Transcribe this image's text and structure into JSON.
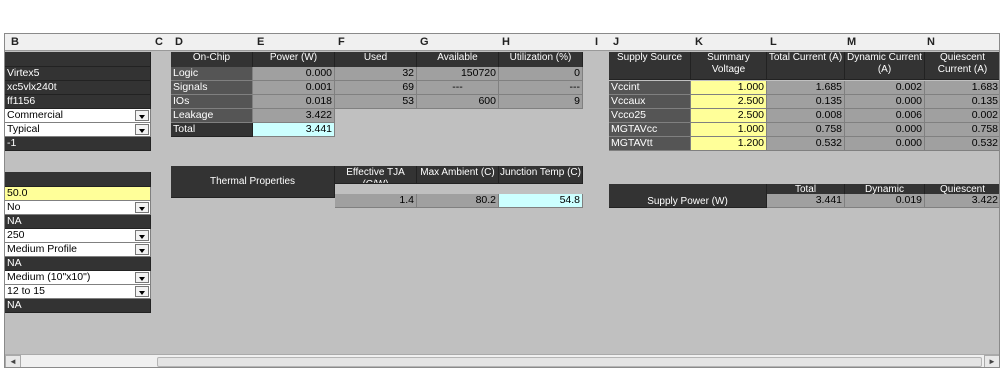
{
  "columns": [
    "B",
    "C",
    "D",
    "E",
    "F",
    "G",
    "H",
    "I",
    "J",
    "K",
    "L",
    "M",
    "N"
  ],
  "settings": {
    "top": [
      {
        "value": "Virtex5",
        "style": "dk"
      },
      {
        "value": "xc5vlx240t",
        "style": "dk"
      },
      {
        "value": "ff1156",
        "style": "dk"
      },
      {
        "value": "Commercial",
        "style": "w",
        "dropdown": true
      },
      {
        "value": "Typical",
        "style": "w",
        "dropdown": true
      },
      {
        "value": "-1",
        "style": "dk"
      }
    ],
    "bottom": [
      {
        "value": "50.0",
        "style": "y"
      },
      {
        "value": "No",
        "style": "w",
        "dropdown": true
      },
      {
        "value": "NA",
        "style": "dk"
      },
      {
        "value": "250",
        "style": "w",
        "dropdown": true
      },
      {
        "value": "Medium Profile",
        "style": "w",
        "dropdown": true
      },
      {
        "value": "NA",
        "style": "dk"
      },
      {
        "value": "Medium (10\"x10\")",
        "style": "w",
        "dropdown": true
      },
      {
        "value": "12 to 15",
        "style": "w",
        "dropdown": true
      },
      {
        "value": "NA",
        "style": "dk"
      }
    ]
  },
  "onchip": {
    "headers": [
      "On-Chip",
      "Power (W)",
      "Used",
      "Available",
      "Utilization (%)"
    ],
    "rows": [
      {
        "name": "Logic",
        "power": "0.000",
        "used": "32",
        "available": "150720",
        "util": "0"
      },
      {
        "name": "Signals",
        "power": "0.001",
        "used": "69",
        "available": "---",
        "util": "---"
      },
      {
        "name": "IOs",
        "power": "0.018",
        "used": "53",
        "available": "600",
        "util": "9"
      },
      {
        "name": "Leakage",
        "power": "3.422",
        "used": "",
        "available": "",
        "util": ""
      },
      {
        "name": "Total",
        "power": "3.441",
        "used": "",
        "available": "",
        "util": ""
      }
    ]
  },
  "thermal": {
    "label": "Thermal Properties",
    "headers": [
      "Effective TJA (C/W)",
      "Max Ambient (C)",
      "Junction Temp (C)"
    ],
    "values": [
      "1.4",
      "80.2",
      "54.8"
    ]
  },
  "supply": {
    "headers": [
      "Supply Source",
      "Summary Voltage",
      "Total Current (A)",
      "Dynamic Current (A)",
      "Quiescent Current (A)"
    ],
    "rows": [
      {
        "source": "Vccint",
        "voltage": "1.000",
        "total": "1.685",
        "dynamic": "0.002",
        "quiescent": "1.683"
      },
      {
        "source": "Vccaux",
        "voltage": "2.500",
        "total": "0.135",
        "dynamic": "0.000",
        "quiescent": "0.135"
      },
      {
        "source": "Vcco25",
        "voltage": "2.500",
        "total": "0.008",
        "dynamic": "0.006",
        "quiescent": "0.002"
      },
      {
        "source": "MGTAVcc",
        "voltage": "1.000",
        "total": "0.758",
        "dynamic": "0.000",
        "quiescent": "0.758"
      },
      {
        "source": "MGTAVtt",
        "voltage": "1.200",
        "total": "0.532",
        "dynamic": "0.000",
        "quiescent": "0.532"
      }
    ]
  },
  "supply_power": {
    "label": "Supply Power (W)",
    "headers": [
      "Total",
      "Dynamic",
      "Quiescent"
    ],
    "values": [
      "3.441",
      "0.019",
      "3.422"
    ]
  },
  "scrollbar": {
    "left_arrow": "◄",
    "right_arrow": "►"
  },
  "colors": {
    "dark_header": "#333333",
    "input_yellow": "#ffff99",
    "result_cyan": "#ccffff",
    "grid_gray": "#c0c0c0"
  }
}
